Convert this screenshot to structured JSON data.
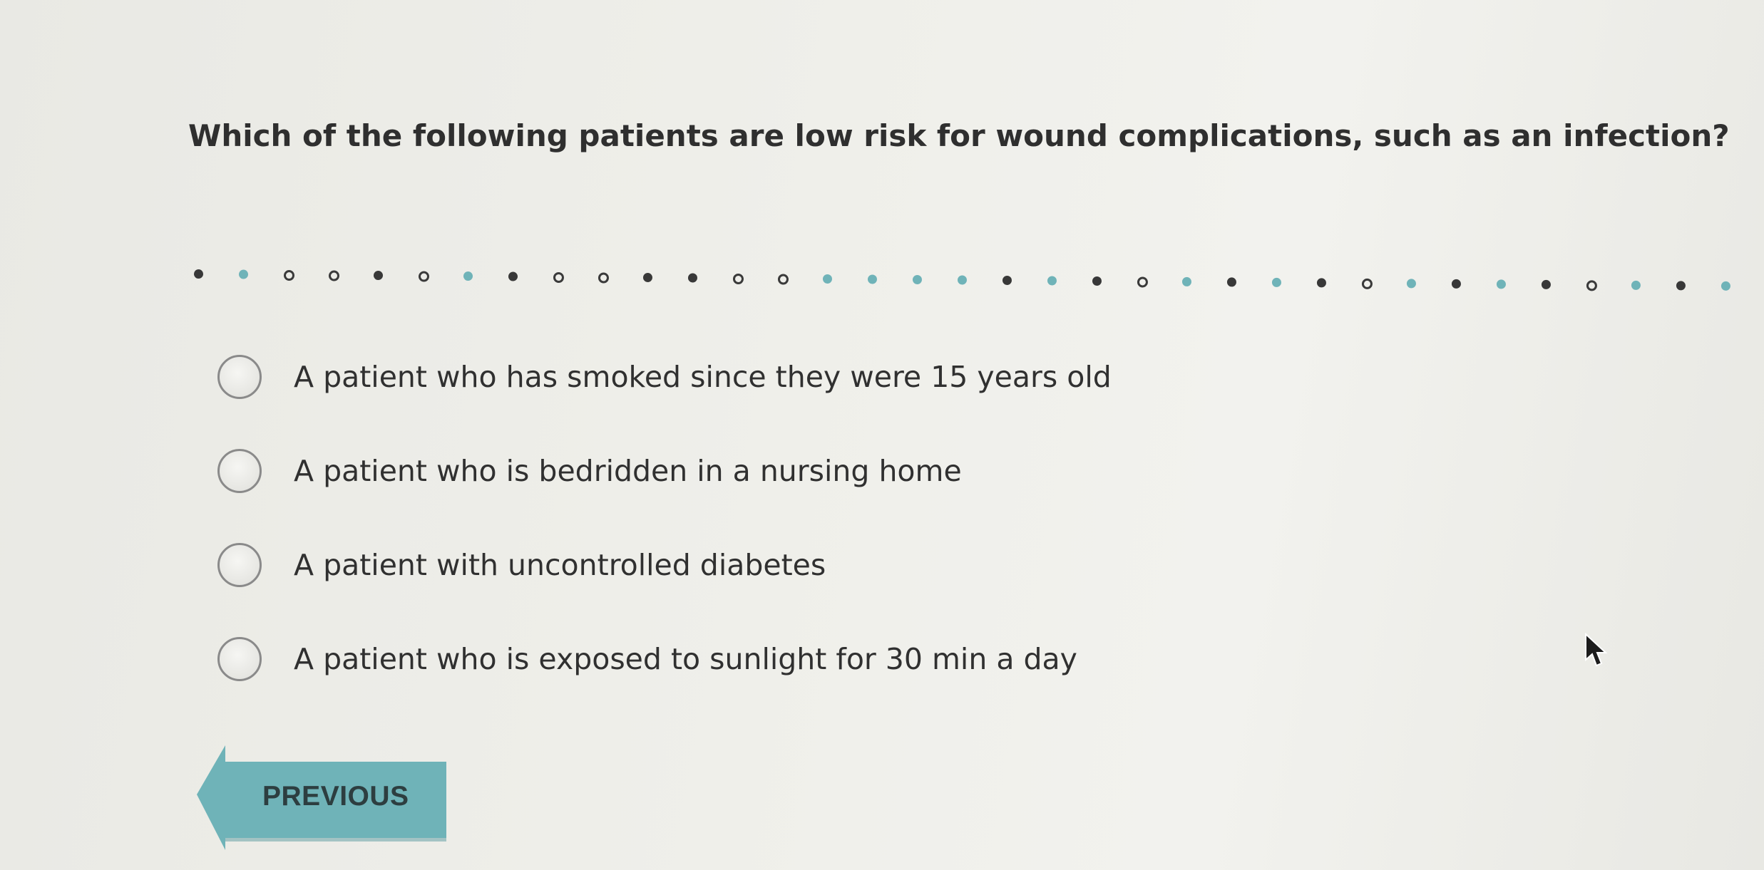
{
  "question": {
    "text": "Which of the following patients are low risk for wound complications, such as an infection?"
  },
  "progress_dots": [
    "filled",
    "teal",
    "ring",
    "ring",
    "filled",
    "ring",
    "teal",
    "filled",
    "ring",
    "ring",
    "filled",
    "filled",
    "ring",
    "ring",
    "teal",
    "teal",
    "teal",
    "teal",
    "filled",
    "teal",
    "filled",
    "ring",
    "teal",
    "filled",
    "teal",
    "filled",
    "ring",
    "teal",
    "filled",
    "teal",
    "filled",
    "ring",
    "teal",
    "filled",
    "teal"
  ],
  "options": [
    {
      "label": "A patient who has smoked since they were 15 years old",
      "selected": false
    },
    {
      "label": "A patient who is bedridden in a nursing home",
      "selected": false
    },
    {
      "label": "A patient with uncontrolled diabetes",
      "selected": false
    },
    {
      "label": "A patient who is exposed to sunlight for 30 min a day",
      "selected": false
    }
  ],
  "navigation": {
    "previous_label": "PREVIOUS"
  },
  "colors": {
    "accent_teal": "#6fb3b8",
    "dot_dark": "#383838"
  },
  "icons": {
    "cursor": "mouse-pointer-icon",
    "previous": "left-arrow-icon"
  }
}
